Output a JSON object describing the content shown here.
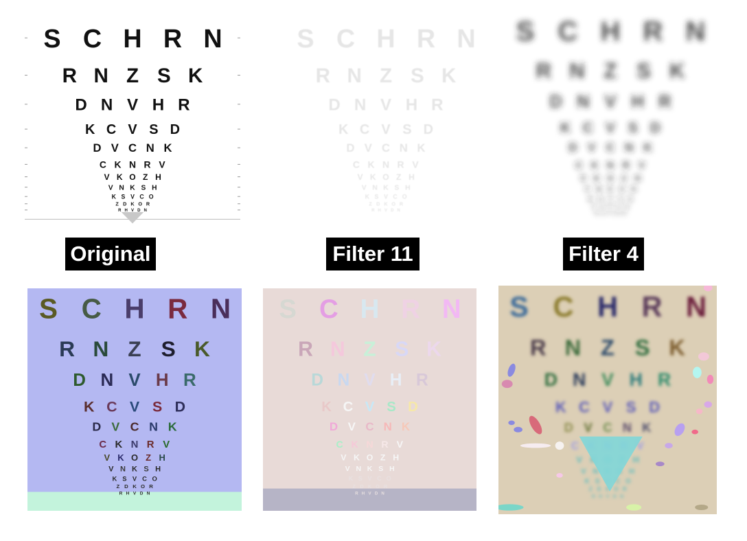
{
  "labels": {
    "original": "Original",
    "filter_a": "Filter 11",
    "filter_b": "Filter 4"
  },
  "chart": {
    "rows": [
      [
        "S",
        "C",
        "H",
        "R",
        "N"
      ],
      [
        "R",
        "N",
        "Z",
        "S",
        "K"
      ],
      [
        "D",
        "N",
        "V",
        "H",
        "R"
      ],
      [
        "K",
        "C",
        "V",
        "S",
        "D"
      ],
      [
        "D",
        "V",
        "C",
        "N",
        "K"
      ],
      [
        "C",
        "K",
        "N",
        "R",
        "V"
      ],
      [
        "V",
        "K",
        "O",
        "Z",
        "H"
      ],
      [
        "V",
        "N",
        "K",
        "S",
        "H"
      ],
      [
        "K",
        "S",
        "V",
        "C",
        "O"
      ],
      [
        "Z",
        "D",
        "K",
        "O",
        "R"
      ],
      [
        "R",
        "H",
        "V",
        "D",
        "N"
      ]
    ]
  },
  "colors": {
    "ink": "#111111",
    "filter11_ink": "#e6e6e6",
    "filter4_ink": "#2a2a2a",
    "seg_bl_bg": "#b4b8f2",
    "seg_bl_floor": "#c3f3dc",
    "seg_bm_bg": "#e8dad7",
    "seg_bm_floor": "#b6b4c6",
    "seg_br_bg": "#dccfb6",
    "seg_br_cone": "#7fd6d8"
  },
  "letter_colors": {
    "bottom_left": [
      [
        "#5a5a24",
        "#475b45",
        "#4a3d6a",
        "#7a2a3e",
        "#4a2e5a"
      ],
      [
        "#2a3a55",
        "#2a4a3a",
        "#3a3f52",
        "#1e1e2e",
        "#4a5a2a"
      ],
      [
        "#2e5a2e",
        "#2a2a55",
        "#2a4a6a",
        "#6a3a4a",
        "#3a6a6a"
      ],
      [
        "#5a2e2e",
        "#6a3a5a",
        "#2a4a7a",
        "#7a2a3a",
        "#2e2e5a"
      ],
      [
        "#2a2a4a",
        "#3a6a3a",
        "#4a2a2a",
        "#2a3a6a",
        "#2a6a3a"
      ],
      [
        "#6a2a4a",
        "#2a2a2a",
        "#3a3a6a",
        "#6a2a2a",
        "#2a6a2a"
      ],
      [
        "#4a4a2a",
        "#2a2a6a",
        "#2a2a2a",
        "#6a2a2a",
        "#2a4a4a"
      ],
      [
        "#2a2a2a",
        "#3a3a3a",
        "#2a2a2a",
        "#3a3a3a",
        "#2a2a2a"
      ],
      [
        "#2a2a2a",
        "#2a2a2a",
        "#2a2a2a",
        "#2a2a2a",
        "#2a2a2a"
      ],
      [
        "#2a2a2a",
        "#2a2a2a",
        "#2a2a2a",
        "#2a2a2a",
        "#2a2a2a"
      ],
      [
        "#2a2a2a",
        "#2a2a2a",
        "#2a2a2a",
        "#2a2a2a",
        "#2a2a2a"
      ]
    ],
    "bottom_middle": [
      [
        "#d6d8d2",
        "#e49ee4",
        "#d8e8f0",
        "#efd2e4",
        "#f2b8f4"
      ],
      [
        "#c9a6b8",
        "#f4c8dc",
        "#c8f0d8",
        "#d8d8f6",
        "#ecd8ec"
      ],
      [
        "#b8d8d8",
        "#c8d8f0",
        "#e0dcee",
        "#e8eef6",
        "#d8c8d8"
      ],
      [
        "#e8c8c8",
        "#f6f6f6",
        "#c8e8f6",
        "#a8e8c8",
        "#f6e8a8"
      ],
      [
        "#f0a8d8",
        "#f6f6f6",
        "#e8b8c8",
        "#f6b8b8",
        "#f6c8b8"
      ],
      [
        "#a8f0c8",
        "#f6c8d8",
        "#f6d8d8",
        "#f6e8e8",
        "#f6f6f6"
      ],
      [
        "#f6f6f6",
        "#f6f6f6",
        "#f6f6f6",
        "#f6f6f6",
        "#f6f6f6"
      ],
      [
        "#f6f6f6",
        "#f6f6f6",
        "#f6f6f6",
        "#f6f6f6",
        "#f6f6f6"
      ],
      [
        "#e8e0e0",
        "#e8e0e0",
        "#e8e0e0",
        "#e8e0e0",
        "#e8e0e0"
      ],
      [
        "#e8e0e0",
        "#e8e0e0",
        "#e8e0e0",
        "#e8e0e0",
        "#e8e0e0"
      ],
      [
        "#e8e0e0",
        "#e8e0e0",
        "#e8e0e0",
        "#e8e0e0",
        "#e8e0e0"
      ]
    ],
    "bottom_right": [
      [
        "#3a6a9a",
        "#8a7a2a",
        "#2a2a6a",
        "#5a3a5a",
        "#6a1a3a"
      ],
      [
        "#4a3a4a",
        "#3a6a3a",
        "#2a4a6a",
        "#2a6a3a",
        "#7a5a2a"
      ],
      [
        "#2a6a3a",
        "#2a3a5a",
        "#3a8a5a",
        "#2a7a7a",
        "#2a8a6a"
      ],
      [
        "#5a5ab8",
        "#5a5ab8",
        "#5a5ab8",
        "#5a5ab8",
        "#5a5ab8"
      ],
      [
        "#8a8a4a",
        "#5a6a2a",
        "#6a8a4a",
        "#5a4a6a",
        "#4a4a6a"
      ],
      [
        "#9a9ae8",
        "#9a9ae8",
        "#9a9ae8",
        "#9a9ae8",
        "#9a9ae8"
      ],
      [
        "#5fbcbe",
        "#5fbcbe",
        "#5fbcbe",
        "#5fbcbe",
        "#5fbcbe"
      ],
      [
        "#5fbcbe",
        "#5fbcbe",
        "#5fbcbe",
        "#5fbcbe",
        "#5fbcbe"
      ],
      [
        "#5fbcbe",
        "#5fbcbe",
        "#5fbcbe",
        "#5fbcbe",
        "#5fbcbe"
      ],
      [
        "#5fbcbe",
        "#5fbcbe",
        "#5fbcbe",
        "#5fbcbe",
        "#5fbcbe"
      ],
      [
        "#5fbcbe",
        "#5fbcbe",
        "#5fbcbe",
        "#5fbcbe",
        "#5fbcbe"
      ]
    ]
  }
}
